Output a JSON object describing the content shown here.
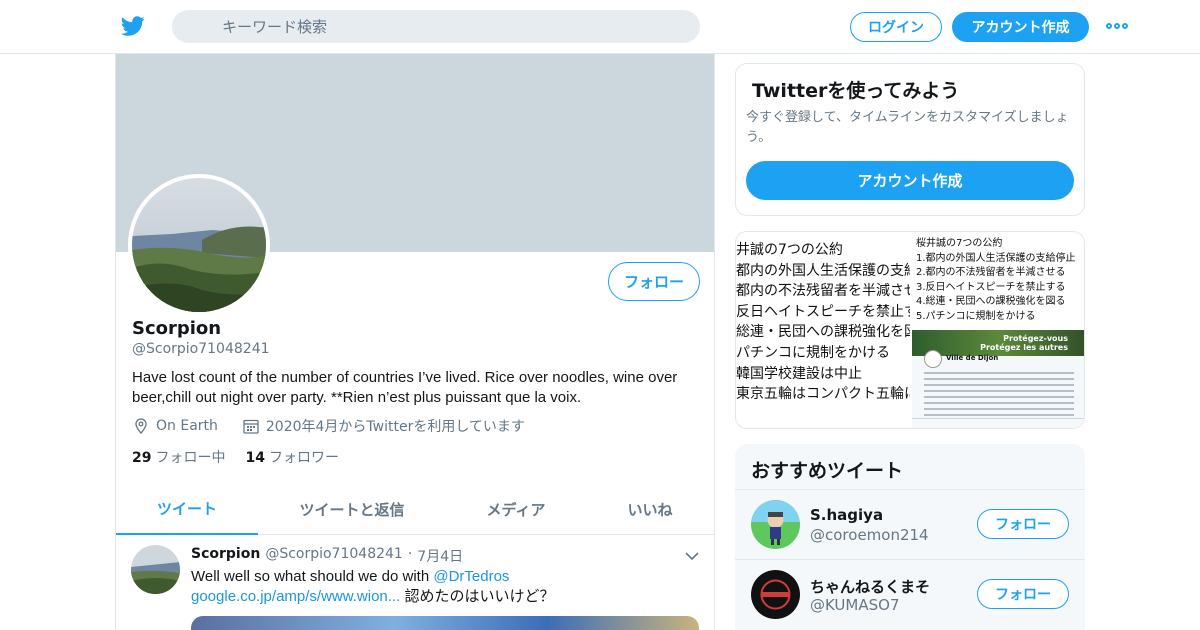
{
  "nav": {
    "search_placeholder": "キーワード検索",
    "login_label": "ログイン",
    "signup_label": "アカウント作成",
    "logo_icon": "twitter-bird-icon",
    "accent_color": "#1da1f2"
  },
  "profile": {
    "follow_label": "フォロー",
    "name": "Scorpion",
    "handle": "@Scorpio71048241",
    "bio": "Have lost count of the number of countries I’ve lived. Rice over noodles, wine over beer,chill out night over party. **Rien n’est plus puissant que la voix.",
    "location": "On Earth",
    "joined": "2020年4月からTwitterを利用しています",
    "following_count": "29",
    "following_label": "フォロー中",
    "followers_count": "14",
    "followers_label": "フォロワー"
  },
  "tabs": [
    {
      "label": "ツイート",
      "active": true
    },
    {
      "label": "ツイートと返信",
      "active": false
    },
    {
      "label": "メディア",
      "active": false
    },
    {
      "label": "いいね",
      "active": false
    }
  ],
  "tweet": {
    "name": "Scorpion",
    "handle": "@Scorpio71048241",
    "separator": "·",
    "date": "7月4日",
    "text_prefix": "Well well so what should we do with ",
    "mention": "@DrTedros",
    "link": "google.co.jp/amp/s/www.wion...",
    "text_suffix": " 認めたのはいいけど？"
  },
  "signup_card": {
    "title": "Twitterを使ってみよう",
    "description": "今すぐ登録して、タイムラインをカスタマイズしましょう。",
    "button_label": "アカウント作成"
  },
  "media_card": {
    "left_lines": [
      "井誠の7つの公約",
      "都内の外国人生活保護の支給",
      "都内の不法残留者を半減させ",
      "反日ヘイトスピーチを禁止す",
      "総連・民団への課税強化を図",
      "パチンコに規制をかける",
      "韓国学校建設は中止",
      "東京五輪はコンパクト五輪に"
    ],
    "right_lines": [
      "桜井誠の7つの公約",
      "1.都内の外国人生活保護の支給停止",
      "2.都内の不法残留者を半減させる",
      "3.反日ヘイトスピーチを禁止する",
      "4.総連・民団への課税強化を図る",
      "5.パチンコに規制をかける"
    ],
    "shot_banner": "Protégez-vous\nProtégez les autres",
    "shot_account": "Ville de Dijon"
  },
  "recommended": {
    "title": "おすすめツイート",
    "users": [
      {
        "name": "S.hagiya",
        "handle": "@coroemon214",
        "follow_label": "フォロー"
      },
      {
        "name": "ちゃんねるくまそ",
        "handle": "@KUMASO7",
        "follow_label": "フォロー"
      }
    ]
  }
}
